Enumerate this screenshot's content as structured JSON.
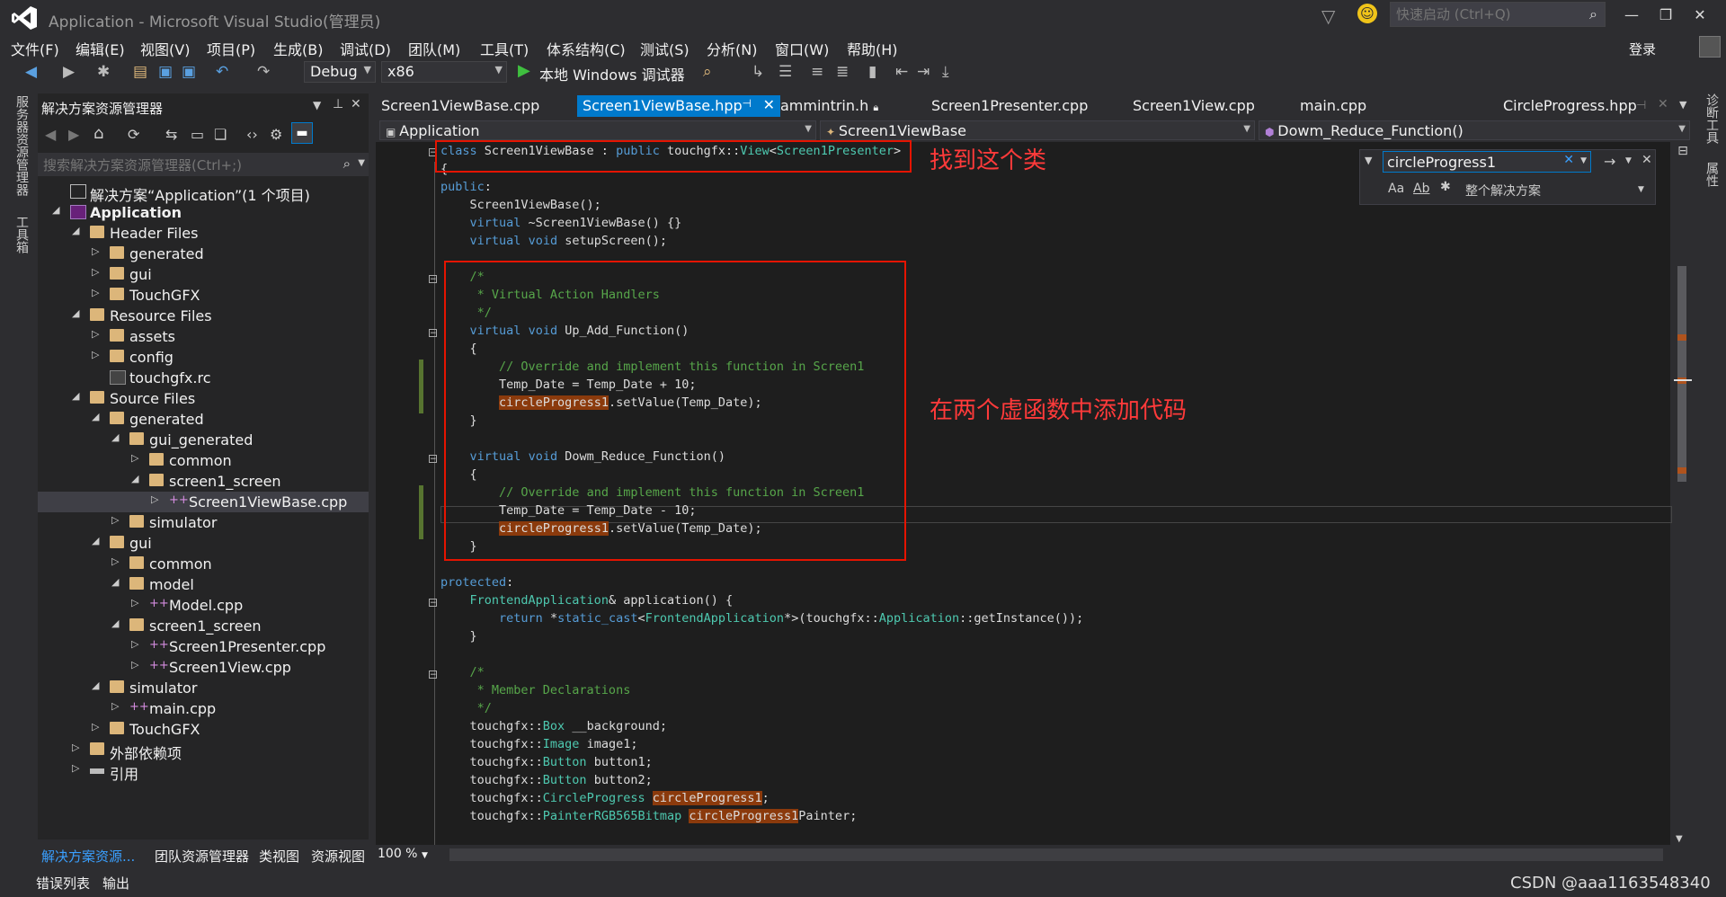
{
  "window": {
    "title": "Application - Microsoft Visual Studio(管理员)",
    "quick_launch_placeholder": "快速启动 (Ctrl+Q)",
    "login": "登录"
  },
  "menu": [
    "文件(F)",
    "编辑(E)",
    "视图(V)",
    "项目(P)",
    "生成(B)",
    "调试(D)",
    "团队(M)",
    "工具(T)",
    "体系结构(C)",
    "测试(S)",
    "分析(N)",
    "窗口(W)",
    "帮助(H)"
  ],
  "toolbar": {
    "config": "Debug",
    "platform": "x86",
    "run_label": "本地 Windows 调试器"
  },
  "left_vertical_tabs": [
    "服务器资源管理器",
    "工具箱"
  ],
  "right_vertical_tabs": [
    "诊断工具",
    "属性"
  ],
  "solution_explorer": {
    "title": "解决方案资源管理器",
    "search_placeholder": "搜索解决方案资源管理器(Ctrl+;)",
    "items": [
      {
        "label": "解决方案“Application”(1 个项目)",
        "depth": 0,
        "icon": "solution",
        "expander": "none"
      },
      {
        "label": "Application",
        "depth": 0,
        "icon": "project",
        "expander": "expanded",
        "bold": true
      },
      {
        "label": "Header Files",
        "depth": 1,
        "icon": "folder",
        "expander": "expanded"
      },
      {
        "label": "generated",
        "depth": 2,
        "icon": "folder",
        "expander": "collapsed"
      },
      {
        "label": "gui",
        "depth": 2,
        "icon": "folder",
        "expander": "collapsed"
      },
      {
        "label": "TouchGFX",
        "depth": 2,
        "icon": "folder",
        "expander": "collapsed"
      },
      {
        "label": "Resource Files",
        "depth": 1,
        "icon": "folder",
        "expander": "expanded"
      },
      {
        "label": "assets",
        "depth": 2,
        "icon": "folder",
        "expander": "collapsed"
      },
      {
        "label": "config",
        "depth": 2,
        "icon": "folder",
        "expander": "collapsed"
      },
      {
        "label": "touchgfx.rc",
        "depth": 2,
        "icon": "rc",
        "expander": "none"
      },
      {
        "label": "Source Files",
        "depth": 1,
        "icon": "folder",
        "expander": "expanded"
      },
      {
        "label": "generated",
        "depth": 2,
        "icon": "folder",
        "expander": "expanded"
      },
      {
        "label": "gui_generated",
        "depth": 3,
        "icon": "folder",
        "expander": "expanded"
      },
      {
        "label": "common",
        "depth": 4,
        "icon": "folder",
        "expander": "collapsed"
      },
      {
        "label": "screen1_screen",
        "depth": 4,
        "icon": "folder",
        "expander": "expanded"
      },
      {
        "label": "Screen1ViewBase.cpp",
        "depth": 5,
        "icon": "cpp",
        "expander": "collapsed",
        "selected": true
      },
      {
        "label": "simulator",
        "depth": 3,
        "icon": "folder",
        "expander": "collapsed"
      },
      {
        "label": "gui",
        "depth": 2,
        "icon": "folder",
        "expander": "expanded"
      },
      {
        "label": "common",
        "depth": 3,
        "icon": "folder",
        "expander": "collapsed"
      },
      {
        "label": "model",
        "depth": 3,
        "icon": "folder",
        "expander": "expanded"
      },
      {
        "label": "Model.cpp",
        "depth": 4,
        "icon": "cpp",
        "expander": "collapsed"
      },
      {
        "label": "screen1_screen",
        "depth": 3,
        "icon": "folder",
        "expander": "expanded"
      },
      {
        "label": "Screen1Presenter.cpp",
        "depth": 4,
        "icon": "cpp",
        "expander": "collapsed"
      },
      {
        "label": "Screen1View.cpp",
        "depth": 4,
        "icon": "cpp",
        "expander": "collapsed"
      },
      {
        "label": "simulator",
        "depth": 2,
        "icon": "folder",
        "expander": "expanded"
      },
      {
        "label": "main.cpp",
        "depth": 3,
        "icon": "cpp",
        "expander": "collapsed"
      },
      {
        "label": "TouchGFX",
        "depth": 2,
        "icon": "folder",
        "expander": "collapsed"
      },
      {
        "label": "外部依赖项",
        "depth": 1,
        "icon": "folder",
        "expander": "collapsed"
      },
      {
        "label": "引用",
        "depth": 1,
        "icon": "refs",
        "expander": "collapsed"
      }
    ],
    "bottom_tabs": [
      "解决方案资源...",
      "团队资源管理器",
      "类视图",
      "资源视图"
    ]
  },
  "bottom_status_tabs": [
    "错误列表",
    "输出"
  ],
  "watermark": "CSDN @aaa1163548340",
  "doc_tabs": [
    {
      "label": "Screen1ViewBase.cpp",
      "active": false
    },
    {
      "label": "Screen1ViewBase.hpp",
      "active": true
    },
    {
      "label": "ammintrin.h",
      "active": false
    },
    {
      "label": "Screen1Presenter.cpp",
      "active": false
    },
    {
      "label": "Screen1View.cpp",
      "active": false
    },
    {
      "label": "main.cpp",
      "active": false
    },
    {
      "label": "CircleProgress.hpp",
      "active": false
    }
  ],
  "nav": {
    "project": "Application",
    "scope": "Screen1ViewBase",
    "member": "Dowm_Reduce_Function()"
  },
  "find": {
    "value": "circleProgress1",
    "scope": "整个解决方案"
  },
  "zoom": "100 %",
  "annotations": {
    "find_class": "找到这个类",
    "add_code": "在两个虚函数中添加代码"
  },
  "colors": {
    "accent": "#007acc",
    "annotation": "#e51400",
    "highlight": "#8b3a0c"
  }
}
